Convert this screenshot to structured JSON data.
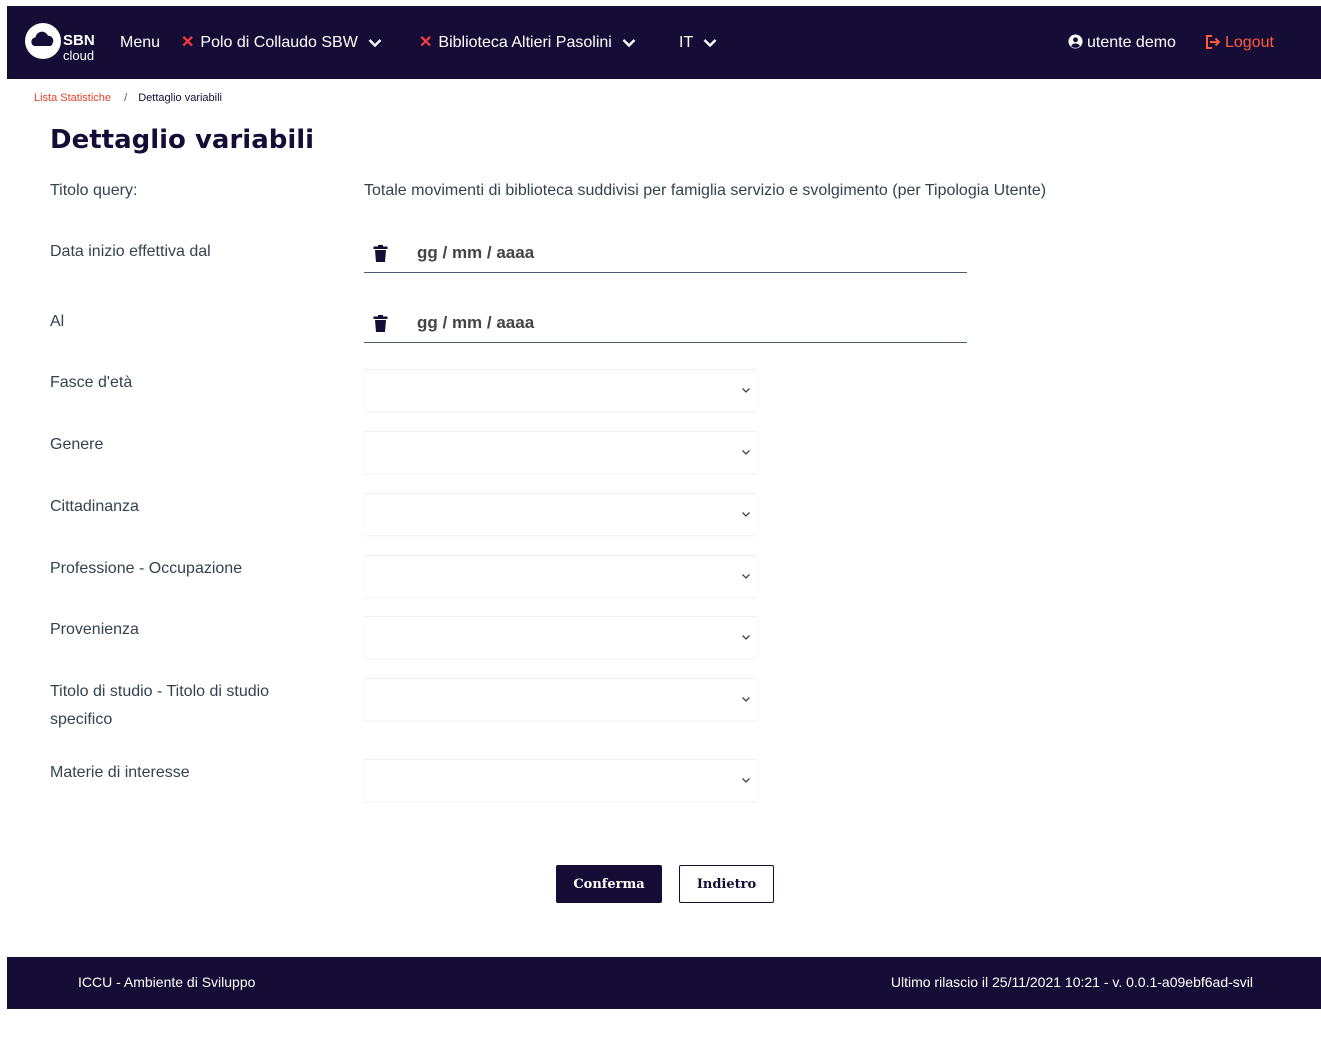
{
  "navbar": {
    "logo_sbn": "SBN",
    "logo_cloud": "cloud",
    "menu": "Menu",
    "polo": "Polo di Collaudo SBW",
    "biblioteca": "Biblioteca Altieri Pasolini",
    "lang": "IT",
    "user": "utente demo",
    "logout": "Logout",
    "colors": {
      "background": "#150d36",
      "accent": "#ff3b3b",
      "logout": "#ff5a3c"
    }
  },
  "breadcrumb": {
    "parent": "Lista Statistiche",
    "separator": "/",
    "current": "Dettaglio variabili"
  },
  "page": {
    "title": "Dettaglio variabili"
  },
  "form": {
    "query_label": "Titolo query:",
    "query_value": "Totale movimenti di biblioteca suddivisi per famiglia servizio e svolgimento (per Tipologia Utente)",
    "date_from_label": "Data inizio effettiva dal",
    "date_from_placeholder": "gg / mm / aaaa",
    "date_to_label": "Al",
    "date_to_placeholder": "gg / mm / aaaa",
    "selects": [
      {
        "label": "Fasce d'età",
        "value": ""
      },
      {
        "label": "Genere",
        "value": ""
      },
      {
        "label": "Cittadinanza",
        "value": ""
      },
      {
        "label": "Professione - Occupazione",
        "value": ""
      },
      {
        "label": "Provenienza",
        "value": ""
      },
      {
        "label_line1": "Titolo di studio - Titolo di studio",
        "label_line2": "specifico",
        "value": ""
      },
      {
        "label": "Materie di interesse",
        "value": ""
      }
    ]
  },
  "actions": {
    "confirm": "Conferma",
    "back": "Indietro"
  },
  "footer": {
    "left": "ICCU - Ambiente di Sviluppo",
    "right": "Ultimo rilascio il 25/11/2021 10:21 - v. 0.0.1-a09ebf6ad-svil"
  }
}
